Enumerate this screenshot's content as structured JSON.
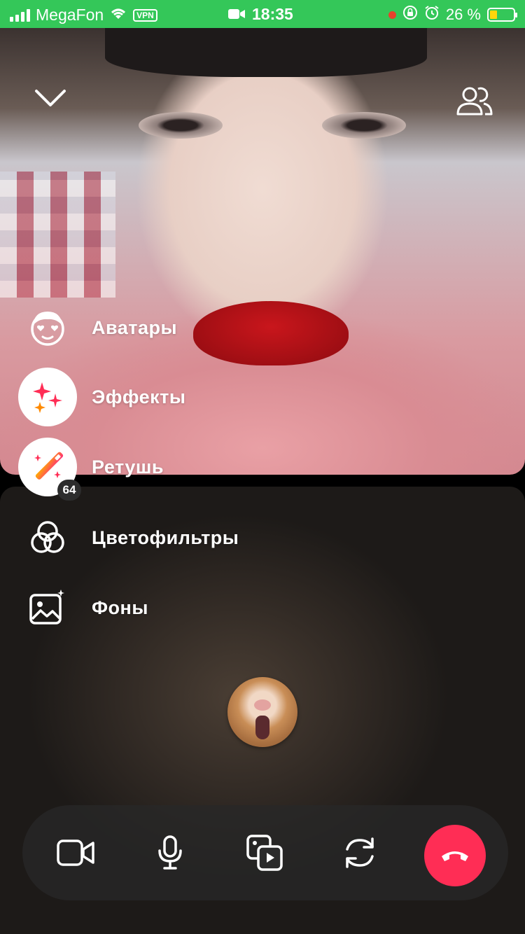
{
  "status_bar": {
    "carrier": "MegaFon",
    "vpn": "VPN",
    "time": "18:35",
    "battery_percent": "26 %",
    "icons": [
      "signal-icon",
      "wifi-icon",
      "video-camera-icon",
      "recording-dot-icon",
      "orientation-lock-icon",
      "alarm-icon",
      "battery-charging-icon"
    ],
    "colors": {
      "background": "#34c759"
    }
  },
  "top_controls": {
    "collapse_icon": "chevron-down-icon",
    "participants_icon": "participants-icon"
  },
  "effects_menu": {
    "items": [
      {
        "label": "Аватары",
        "icon": "avatar-face-icon"
      },
      {
        "label": "Эффекты",
        "icon": "sparkles-icon"
      },
      {
        "label": "Ретушь",
        "icon": "magic-wand-icon",
        "badge": "64"
      },
      {
        "label": "Цветофильтры",
        "icon": "color-filters-icon"
      },
      {
        "label": "Фоны",
        "icon": "backgrounds-icon"
      }
    ]
  },
  "call_controls": {
    "buttons": [
      "camera-icon",
      "microphone-icon",
      "screen-share-icon",
      "switch-camera-icon",
      "end-call-icon"
    ],
    "colors": {
      "end_call": "#ff2d55",
      "bar": "#282828"
    }
  }
}
